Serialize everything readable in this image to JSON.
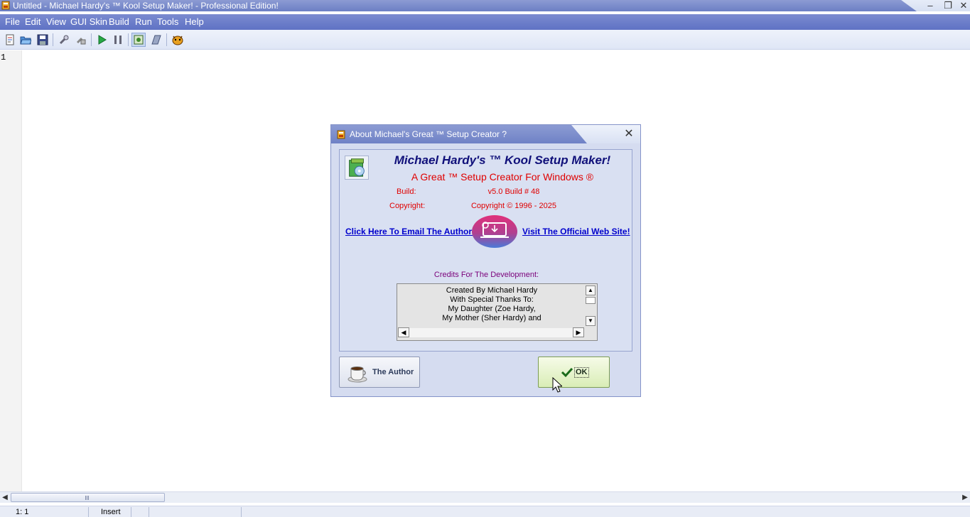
{
  "window": {
    "title": "Untitled - Michael Hardy's ™ Kool Setup Maker! - Professional Edition!",
    "controls": {
      "minimize": "–",
      "restore": "❐",
      "close": "✕"
    }
  },
  "menu": {
    "items": [
      "File",
      "Edit",
      "View",
      "GUI Skin",
      "Build",
      "Run",
      "Tools",
      "Help"
    ]
  },
  "toolbar": {
    "buttons": [
      "new-script-icon",
      "open-folder-icon",
      "save-icon",
      "wrench-icon",
      "hand-tool-icon",
      "run-play-icon",
      "pause-icon",
      "compile-icon",
      "pattern-icon",
      "tiger-icon"
    ]
  },
  "editor": {
    "line_number": "1"
  },
  "statusbar": {
    "position": "1:   1",
    "mode": "Insert"
  },
  "about": {
    "title": "About Michael's Great ™ Setup Creator ?",
    "close": "✕",
    "product_name": "Michael Hardy's ™ Kool Setup Maker!",
    "tagline": "A Great ™ Setup Creator For Windows ®",
    "build_label": "Build:",
    "build_value": "v5.0 Build # 48",
    "copyright_label": "Copyright:",
    "copyright_value": "Copyright © 1996 - 2025",
    "email_link": "Click Here To Email The Author!",
    "website_link": "Visit The Official Web Site!",
    "credits_label": "Credits For The Development:",
    "credits_lines": [
      "Created By Michael Hardy",
      "With Special Thanks To:",
      "My Daughter (Zoe Hardy,",
      "My Mother (Sher Hardy) and"
    ],
    "author_button": "The Author",
    "ok_button": "OK"
  },
  "colors": {
    "titlebar": "#7385c8",
    "dialog_bg": "#d5dcf0",
    "product_name": "#10107a",
    "red_text": "#e00000",
    "link": "#0000cc",
    "credits_label": "#7a007a"
  }
}
